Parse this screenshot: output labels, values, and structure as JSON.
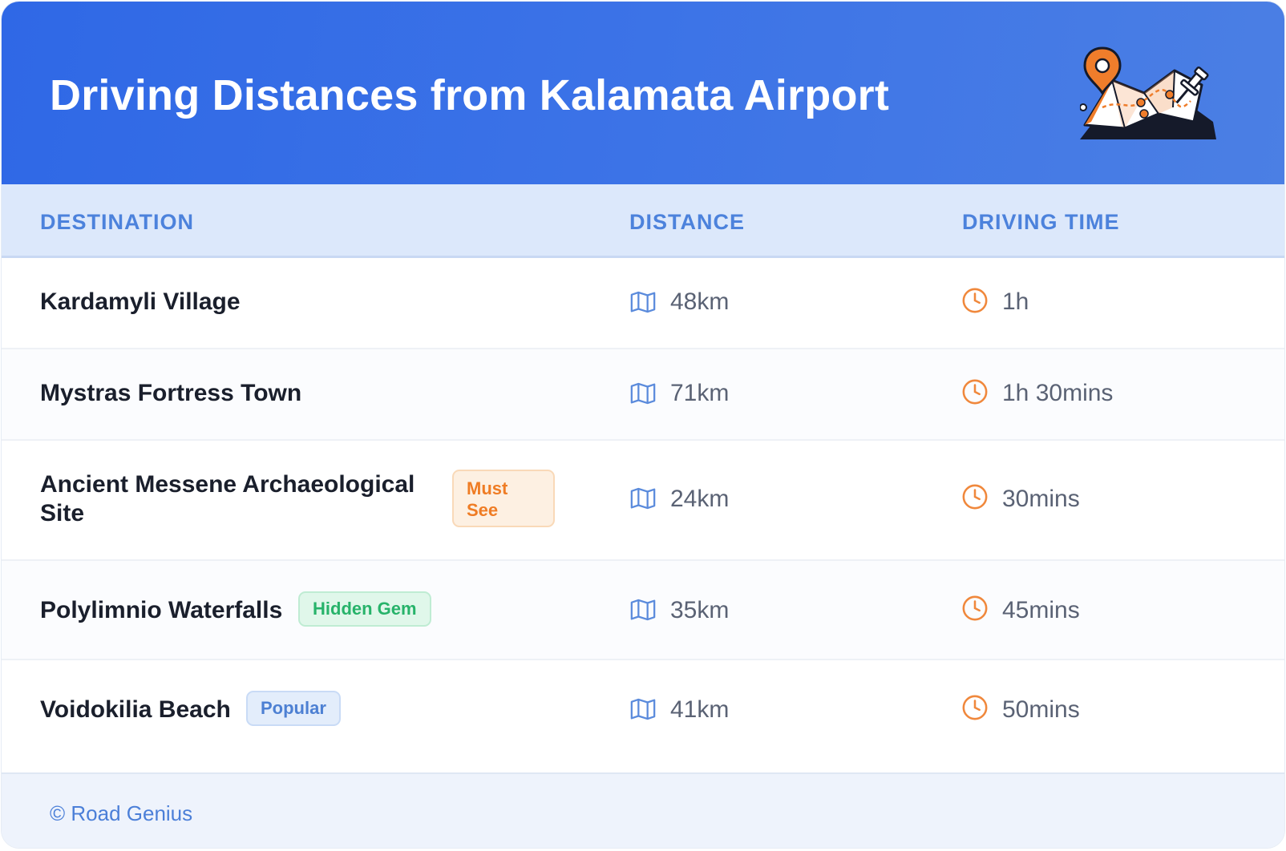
{
  "header": {
    "title": "Driving Distances from Kalamata Airport"
  },
  "columns": {
    "destination": "DESTINATION",
    "distance": "DISTANCE",
    "driving_time": "DRIVING TIME"
  },
  "rows": [
    {
      "destination": "Kardamyli Village",
      "badge": "",
      "distance": "48km",
      "time": "1h"
    },
    {
      "destination": "Mystras Fortress Town",
      "badge": "",
      "distance": "71km",
      "time": "1h 30mins"
    },
    {
      "destination": "Ancient Messene Archaeological Site",
      "destination_lines": [
        "Ancient Messene Archaeological",
        "Site"
      ],
      "badge": "Must See",
      "badge_lines": [
        "Must",
        "See"
      ],
      "distance": "24km",
      "time": "30mins"
    },
    {
      "destination": "Polylimnio Waterfalls",
      "badge": "Hidden Gem",
      "distance": "35km",
      "time": "45mins"
    },
    {
      "destination": "Voidokilia Beach",
      "badge": "Popular",
      "distance": "41km",
      "time": "50mins"
    }
  ],
  "footer": {
    "text": "© Road Genius"
  },
  "colors": {
    "header_gradient_start": "#2f68e6",
    "header_gradient_end": "#4b7fe4",
    "header_row_bg": "#dce8fb",
    "column_header_text": "#4c82dc",
    "map_icon": "#5b8bdc",
    "clock_icon": "#f0883c",
    "badge_must_see": "#ef7c24",
    "badge_hidden_gem": "#27b36a",
    "badge_popular": "#4d80d3"
  },
  "icons": {
    "header_illustration": "map-with-pin-illustration",
    "distance": "map-icon",
    "time": "clock-icon"
  }
}
